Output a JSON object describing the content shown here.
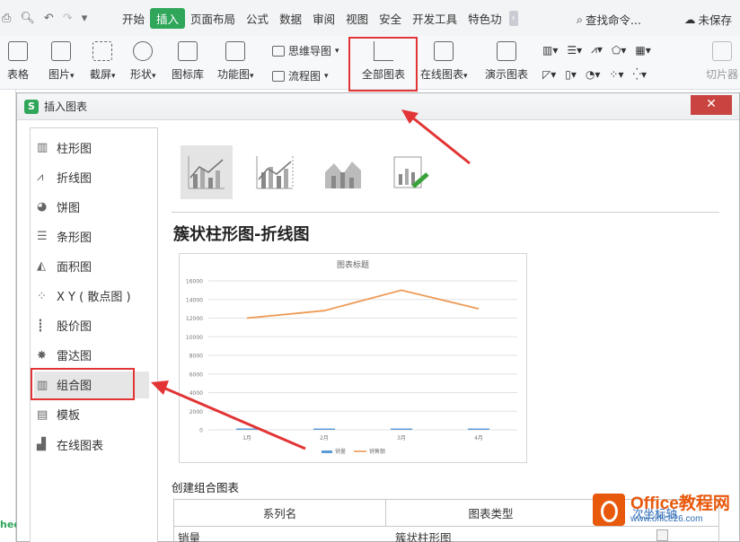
{
  "menubar": {
    "items": [
      {
        "label": "开始",
        "active": false
      },
      {
        "label": "插入",
        "active": true
      },
      {
        "label": "页面布局",
        "active": false
      },
      {
        "label": "公式",
        "active": false
      },
      {
        "label": "数据",
        "active": false
      },
      {
        "label": "审阅",
        "active": false
      },
      {
        "label": "视图",
        "active": false
      },
      {
        "label": "安全",
        "active": false
      },
      {
        "label": "开发工具",
        "active": false
      },
      {
        "label": "特色功",
        "active": false
      }
    ],
    "more": "›",
    "search": "查找命令...",
    "save_status": "未保存"
  },
  "ribbon": {
    "table": "表格",
    "picture": "图片",
    "screenshot": "截屏",
    "shape": "形状",
    "icon_lib": "图标库",
    "func_chart": "功能图",
    "mindmap": "思维导图",
    "flowchart": "流程图",
    "all_charts": "全部图表",
    "online_chart": "在线图表",
    "demo_chart": "演示图表",
    "slice": "切片器"
  },
  "dialog": {
    "title": "插入图表",
    "close": "✕",
    "categories": [
      {
        "label": "柱形图",
        "icon": "bar-chart-icon"
      },
      {
        "label": "折线图",
        "icon": "line-chart-icon"
      },
      {
        "label": "饼图",
        "icon": "pie-chart-icon"
      },
      {
        "label": "条形图",
        "icon": "horizontal-bar-icon"
      },
      {
        "label": "面积图",
        "icon": "area-chart-icon"
      },
      {
        "label": "X Y ( 散点图 )",
        "icon": "scatter-chart-icon"
      },
      {
        "label": "股价图",
        "icon": "stock-chart-icon"
      },
      {
        "label": "雷达图",
        "icon": "radar-chart-icon"
      },
      {
        "label": "组合图",
        "icon": "combo-chart-icon"
      },
      {
        "label": "模板",
        "icon": "template-icon"
      },
      {
        "label": "在线图表",
        "icon": "online-chart-icon"
      }
    ],
    "selected_category": "组合图",
    "chart_title": "簇状柱形图-折线图",
    "section_title": "创建组合图表",
    "table_headers": [
      "系列名",
      "图表类型"
    ],
    "row1": [
      "销量",
      "簇状柱形图"
    ],
    "row1_third": "次坐标轴"
  },
  "chart_data": {
    "type": "line",
    "title": "图表标题",
    "categories": [
      "1月",
      "2月",
      "3月",
      "4月"
    ],
    "ylim": [
      0,
      16000
    ],
    "yticks": [
      0,
      2000,
      4000,
      6000,
      8000,
      10000,
      12000,
      14000,
      16000
    ],
    "series": [
      {
        "name": "销量",
        "type": "bar",
        "values": [
          60,
          80,
          70,
          65
        ],
        "color": "#5b9bd5"
      },
      {
        "name": "销售额",
        "type": "line",
        "values": [
          12000,
          12800,
          15000,
          13000
        ],
        "color": "#ed9a55"
      }
    ],
    "grid": true,
    "legend": "bottom"
  },
  "watermark": {
    "main": "Office教程网",
    "url": "www.office26.com"
  },
  "sheet_tab": "hee"
}
